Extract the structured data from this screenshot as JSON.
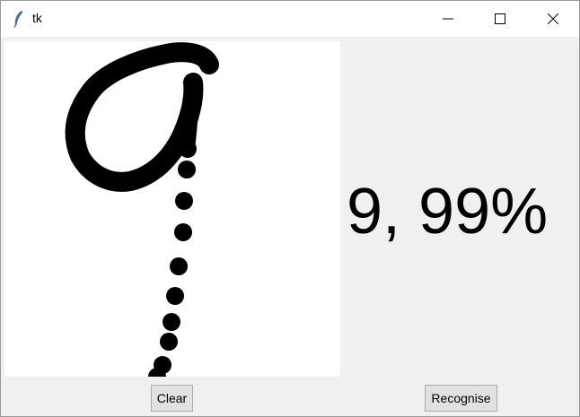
{
  "window": {
    "title": "tk",
    "icon": "tk-feather-icon"
  },
  "titlebar_controls": {
    "minimize_icon": "minimize-icon",
    "maximize_icon": "maximize-icon",
    "close_icon": "close-icon"
  },
  "result": {
    "text": "9, 99%"
  },
  "buttons": {
    "clear_label": "Clear",
    "recognise_label": "Recognise"
  },
  "colors": {
    "window_bg": "#f0f0f0",
    "canvas_bg": "#ffffff",
    "ink": "#000000",
    "button_bg": "#e1e1e1"
  }
}
